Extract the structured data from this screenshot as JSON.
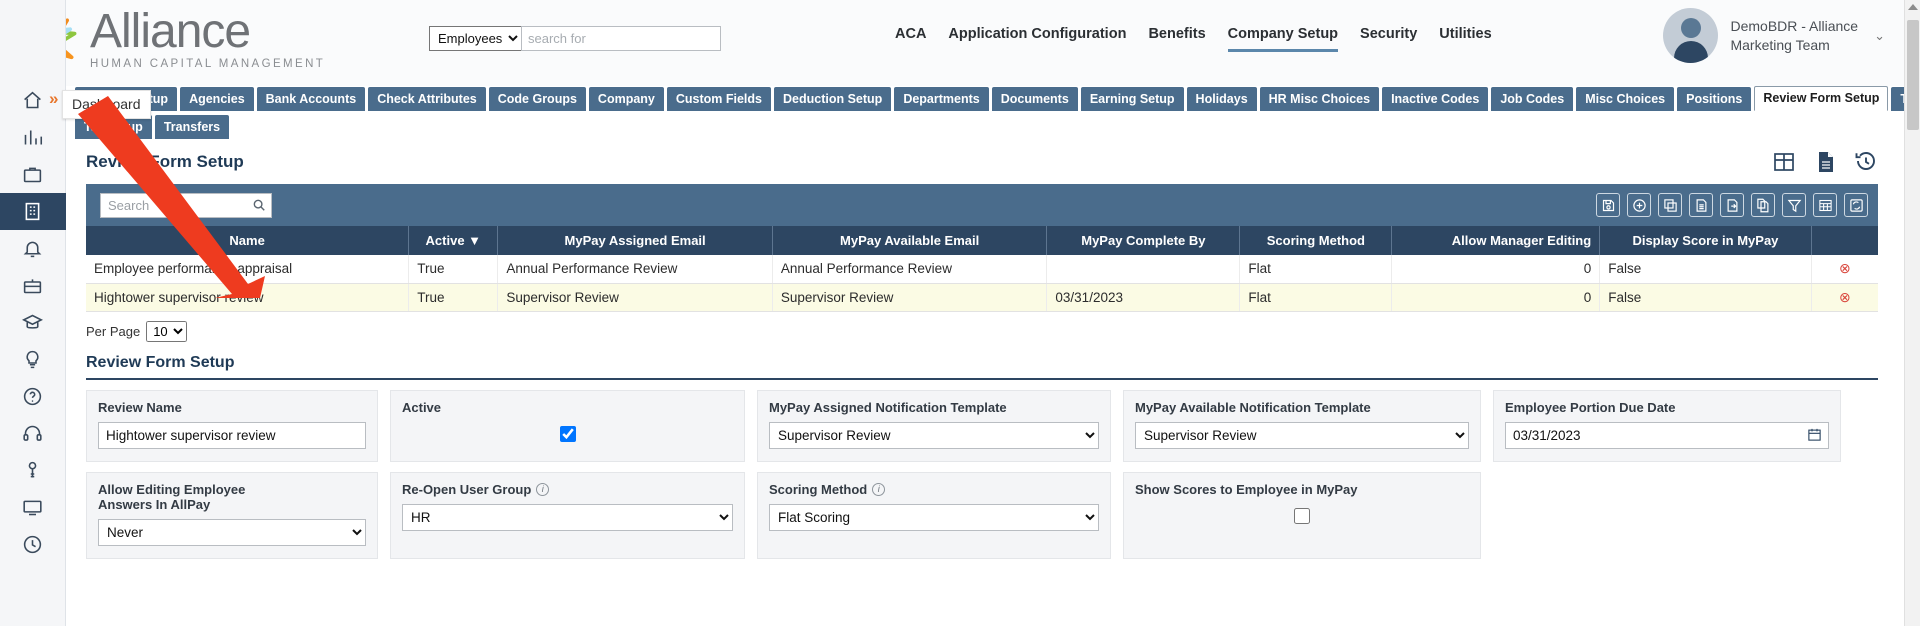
{
  "header": {
    "logo_title": "Alliance",
    "logo_subtitle": "HUMAN CAPITAL MANAGEMENT",
    "search": {
      "scope": "Employees",
      "placeholder": "search for",
      "value": ""
    },
    "nav": [
      {
        "label": "ACA",
        "active": false
      },
      {
        "label": "Application Configuration",
        "active": false
      },
      {
        "label": "Benefits",
        "active": false
      },
      {
        "label": "Company Setup",
        "active": true
      },
      {
        "label": "Security",
        "active": false
      },
      {
        "label": "Utilities",
        "active": false
      }
    ],
    "user": {
      "line1": "DemoBDR - Alliance",
      "line2": "Marketing Team",
      "caret": "⌄"
    }
  },
  "rail": {
    "expand_glyph": "»",
    "tooltip": "Dashboard",
    "items": [
      {
        "name": "home-icon",
        "active": false
      },
      {
        "name": "analytics-icon",
        "active": false
      },
      {
        "name": "briefcase-icon",
        "active": false
      },
      {
        "name": "building-icon",
        "active": true
      },
      {
        "name": "bell-icon",
        "active": false
      },
      {
        "name": "benefits-icon",
        "active": false
      },
      {
        "name": "graduation-icon",
        "active": false
      },
      {
        "name": "lightbulb-icon",
        "active": false
      },
      {
        "name": "help-icon",
        "active": false
      },
      {
        "name": "headset-icon",
        "active": false
      },
      {
        "name": "key-icon",
        "active": false
      },
      {
        "name": "monitor-icon",
        "active": false
      },
      {
        "name": "clock-icon",
        "active": false
      }
    ]
  },
  "tabs": {
    "row1": [
      {
        "label": "Accrual Setup",
        "active": false
      },
      {
        "label": "Agencies",
        "active": false
      },
      {
        "label": "Bank Accounts",
        "active": false
      },
      {
        "label": "Check Attributes",
        "active": false
      },
      {
        "label": "Code Groups",
        "active": false
      },
      {
        "label": "Company",
        "active": false
      },
      {
        "label": "Custom Fields",
        "active": false
      },
      {
        "label": "Deduction Setup",
        "active": false
      },
      {
        "label": "Departments",
        "active": false
      },
      {
        "label": "Documents",
        "active": false
      },
      {
        "label": "Earning Setup",
        "active": false
      },
      {
        "label": "Holidays",
        "active": false
      },
      {
        "label": "HR Misc Choices",
        "active": false
      },
      {
        "label": "Inactive Codes",
        "active": false
      },
      {
        "label": "Job Codes",
        "active": false
      },
      {
        "label": "Misc Choices",
        "active": false
      },
      {
        "label": "Positions",
        "active": false
      },
      {
        "label": "Review Form Setup",
        "active": true
      },
      {
        "label": "Tax Documents",
        "active": false
      }
    ],
    "row2": [
      {
        "label": "Tax Setup",
        "active": false
      },
      {
        "label": "Transfers",
        "active": false
      }
    ]
  },
  "page": {
    "title": "Review Form Setup",
    "head_icons": [
      {
        "name": "grid-view-icon"
      },
      {
        "name": "document-icon"
      },
      {
        "name": "history-icon"
      }
    ]
  },
  "grid": {
    "search_placeholder": "Search",
    "search_value": "",
    "tools": [
      {
        "name": "save-icon"
      },
      {
        "name": "add-icon"
      },
      {
        "name": "copy-layers-icon"
      },
      {
        "name": "document-icon"
      },
      {
        "name": "export-icon"
      },
      {
        "name": "duplicate-icon"
      },
      {
        "name": "filter-icon"
      },
      {
        "name": "table-grid-icon"
      },
      {
        "name": "refresh-icon"
      }
    ],
    "columns": [
      {
        "label": "Name",
        "align": "center"
      },
      {
        "label": "Active ▼",
        "align": "center"
      },
      {
        "label": "MyPay Assigned Email",
        "align": "center"
      },
      {
        "label": "MyPay Available Email",
        "align": "center"
      },
      {
        "label": "MyPay Complete By",
        "align": "center"
      },
      {
        "label": "Scoring Method",
        "align": "center"
      },
      {
        "label": "Allow Manager Editing",
        "align": "right"
      },
      {
        "label": "Display Score in MyPay",
        "align": "center"
      },
      {
        "label": "",
        "align": "center"
      }
    ],
    "rows": [
      {
        "selected": false,
        "name": "Employee performance appraisal",
        "active": "True",
        "assigned_email": "Annual Performance Review",
        "available_email": "Annual Performance Review",
        "complete_by": "",
        "scoring_method": "Flat",
        "allow_manager_editing": "0",
        "display_score": "False",
        "delete_glyph": "⊗"
      },
      {
        "selected": true,
        "name": "Hightower supervisor review",
        "active": "True",
        "assigned_email": "Supervisor Review",
        "available_email": "Supervisor Review",
        "complete_by": "03/31/2023",
        "scoring_method": "Flat",
        "allow_manager_editing": "0",
        "display_score": "False",
        "delete_glyph": "⊗"
      }
    ],
    "per_page_label": "Per Page",
    "per_page_value": "10"
  },
  "detail": {
    "title": "Review Form Setup",
    "review_name_label": "Review Name",
    "review_name_value": "Hightower supervisor review",
    "active_label": "Active",
    "active_checked": true,
    "assigned_template_label": "MyPay Assigned Notification Template",
    "assigned_template_value": "Supervisor Review",
    "available_template_label": "MyPay Available Notification Template",
    "available_template_value": "Supervisor Review",
    "due_date_label": "Employee Portion Due Date",
    "due_date_value": "03/31/2023",
    "allow_editing_label_l1": "Allow Editing Employee",
    "allow_editing_label_l2": "Answers In AllPay",
    "allow_editing_value": "Never",
    "reopen_group_label": "Re-Open User Group",
    "reopen_group_value": "HR",
    "scoring_method_label": "Scoring Method",
    "scoring_method_value": "Flat Scoring",
    "show_scores_label": "Show Scores to Employee in MyPay",
    "show_scores_checked": false,
    "info_glyph": "i"
  },
  "colors": {
    "nav_accent": "#5b87ab",
    "tab_blue": "#4a6c8c",
    "header_blue": "#2d4662",
    "selected_row": "#fbfbe4",
    "delete_red": "#d9453b",
    "arrow_red": "#ee3b1f"
  }
}
